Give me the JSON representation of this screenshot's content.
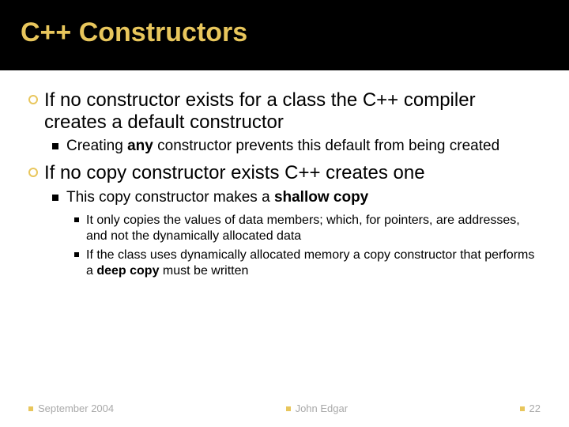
{
  "title": "C++ Constructors",
  "bullets": {
    "b1_pre": "If no constructor exists for a class the C++ compiler creates a default constructor",
    "b1a_pre": "Creating ",
    "b1a_bold": "any",
    "b1a_post": " constructor prevents this default from being created",
    "b2": "If no copy constructor exists C++ creates one",
    "b2a_pre": "This copy constructor makes a ",
    "b2a_bold": "shallow copy",
    "b2a1": "It only copies the values of data members; which, for pointers, are addresses, and not the dynamically allocated data",
    "b2a2_pre": "If the class uses dynamically allocated memory a copy constructor that performs a ",
    "b2a2_bold": "deep copy",
    "b2a2_post": " must be written"
  },
  "footer": {
    "date": "September 2004",
    "author": "John Edgar",
    "page": "22"
  }
}
